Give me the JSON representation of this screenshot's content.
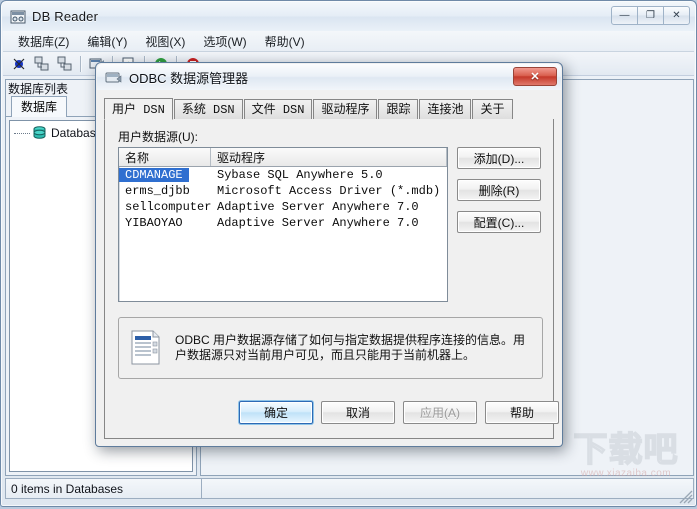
{
  "app": {
    "title": "DB Reader",
    "icon": "app-db-icon",
    "window_buttons": [
      {
        "name": "minimize",
        "glyph": "—"
      },
      {
        "name": "maximize",
        "glyph": "❐"
      },
      {
        "name": "close",
        "glyph": "✕"
      }
    ],
    "menu": [
      {
        "label": "数据库(Z)",
        "text": "数据库",
        "key": "Z"
      },
      {
        "label": "编辑(Y)",
        "text": "编辑",
        "key": "Y"
      },
      {
        "label": "视图(X)",
        "text": "视图",
        "key": "X"
      },
      {
        "label": "选项(W)",
        "text": "选项",
        "key": "W"
      },
      {
        "label": "帮助(V)",
        "text": "帮助",
        "key": "V"
      }
    ],
    "toolbar": [
      {
        "name": "connect-icon"
      },
      {
        "name": "server-icon"
      },
      {
        "name": "server-alt-icon"
      },
      {
        "name": "separator"
      },
      {
        "name": "query-icon"
      },
      {
        "name": "separator"
      },
      {
        "name": "export-icon"
      },
      {
        "name": "separator"
      },
      {
        "name": "run-icon"
      },
      {
        "name": "separator"
      },
      {
        "name": "stop-icon"
      }
    ],
    "left_panel": {
      "header": "数据库列表",
      "tab": "数据库",
      "tree_node": "Databases"
    },
    "status": {
      "text": "0 items in Databases"
    },
    "watermark": {
      "text": "下载吧",
      "url": "www.xiazaiba.com"
    }
  },
  "dialog": {
    "title": "ODBC 数据源管理器",
    "icon": "odbc-icon",
    "close_glyph": "✕",
    "tabs": [
      {
        "label": "用户 DSN",
        "active": true
      },
      {
        "label": "系统 DSN",
        "active": false
      },
      {
        "label": "文件 DSN",
        "active": false
      },
      {
        "label": "驱动程序",
        "active": false
      },
      {
        "label": "跟踪",
        "active": false
      },
      {
        "label": "连接池",
        "active": false
      },
      {
        "label": "关于",
        "active": false
      }
    ],
    "source_label": "用户数据源(U):",
    "list": {
      "columns": [
        "名称",
        "驱动程序"
      ],
      "rows": [
        {
          "name": "CDMANAGE",
          "driver": "Sybase SQL Anywhere 5.0",
          "selected": true
        },
        {
          "name": "erms_djbb",
          "driver": "Microsoft Access Driver (*.mdb)",
          "selected": false
        },
        {
          "name": "sellcomputer",
          "driver": "Adaptive Server Anywhere 7.0",
          "selected": false
        },
        {
          "name": "YIBAOYAO",
          "driver": "Adaptive Server Anywhere 7.0",
          "selected": false
        }
      ],
      "selection_color": "#2f6fd0"
    },
    "side_buttons": [
      {
        "label": "添加(D)...",
        "name": "add-button"
      },
      {
        "label": "删除(R)",
        "name": "remove-button"
      },
      {
        "label": "配置(C)...",
        "name": "configure-button"
      }
    ],
    "description": {
      "icon": "data-source-icon",
      "text": "ODBC 用户数据源存储了如何与指定数据提供程序连接的信息。用户数据源只对当前用户可见，而且只能用于当前机器上。"
    },
    "footer_buttons": [
      {
        "label": "确定",
        "name": "ok-button",
        "style": "default"
      },
      {
        "label": "取消",
        "name": "cancel-button",
        "style": "normal"
      },
      {
        "label": "应用(A)",
        "name": "apply-button",
        "style": "disabled"
      },
      {
        "label": "帮助",
        "name": "help-button",
        "style": "normal"
      }
    ]
  }
}
